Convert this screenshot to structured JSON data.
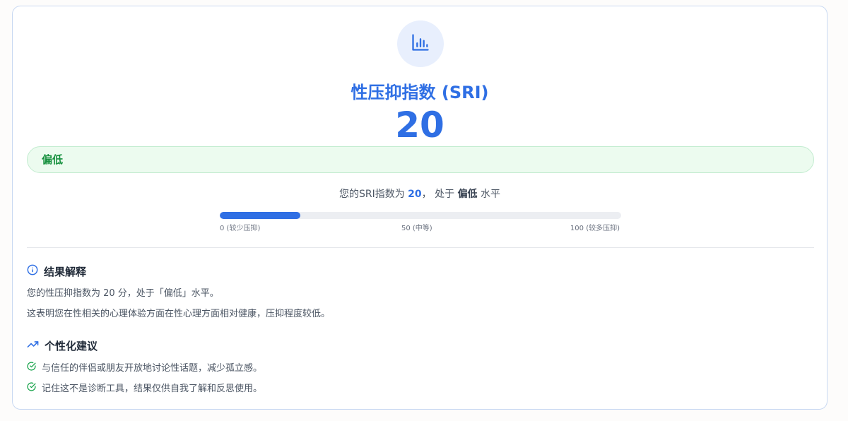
{
  "header": {
    "icon": "bar-chart-icon",
    "title": "性压抑指数 (SRI)",
    "score": "20"
  },
  "level_badge": "偏低",
  "summary": {
    "prefix": "您的SRI指数为",
    "score": "20",
    "mid": "， 处于",
    "level": "偏低",
    "suffix": "水平"
  },
  "progress": {
    "value": 20,
    "max": 100,
    "fraction": 0.2,
    "labels": {
      "min": "0 (较少压抑)",
      "mid": "50 (中等)",
      "max": "100 (较多压抑)"
    }
  },
  "interpretation": {
    "icon": "info-icon",
    "heading": "结果解释",
    "lines": [
      "您的性压抑指数为 20 分，处于「偏低」水平。",
      "这表明您在性相关的心理体验方面在性心理方面相对健康，压抑程度较低。"
    ]
  },
  "suggestions": {
    "icon": "trending-up-icon",
    "heading": "个性化建议",
    "items": [
      "与信任的伴侣或朋友开放地讨论性话题，减少孤立感。",
      "记住这不是诊断工具，结果仅供自我了解和反思使用。"
    ]
  },
  "colors": {
    "accent": "#2f6fe4",
    "success": "#17913f",
    "success_bg": "#ecfbef"
  }
}
